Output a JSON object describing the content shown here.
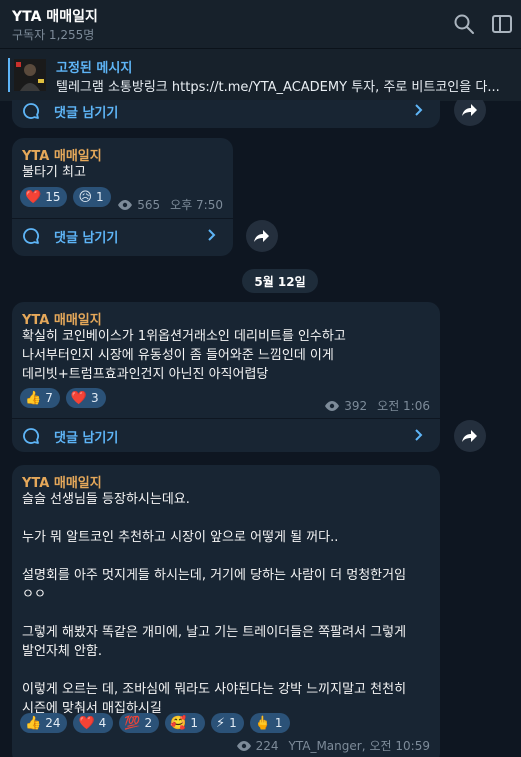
{
  "header": {
    "title": "YTA 매매일지",
    "subscribers": "구독자 1,255명"
  },
  "pinned": {
    "title": "고정된 메시지",
    "text": "텔레그램 소통방링크 https://t.me/YTA_ACADEMY 투자, 주로 비트코인을 다..."
  },
  "comments_label": "댓글 남기기",
  "date_separator": "5월 12일",
  "messages": [
    {
      "sender": "YTA 매매일지",
      "text": "불타기 최고",
      "reactions": [
        {
          "emoji": "❤️",
          "count": "15"
        },
        {
          "emoji": "😥",
          "count": "1"
        }
      ],
      "views": "565",
      "time": "오후 7:50"
    },
    {
      "sender": "YTA 매매일지",
      "text": "확실히 코인베이스가 1위옵션거래소인 데리비트를 인수하고\n나서부터인지 시장에 유동성이 좀 들어와준 느낌인데 이게\n데리빗+트럼프효과인건지 아닌진 아직어렵당",
      "reactions": [
        {
          "emoji": "👍",
          "count": "7"
        },
        {
          "emoji": "❤️",
          "count": "3"
        }
      ],
      "views": "392",
      "time": "오전 1:06"
    },
    {
      "sender": "YTA 매매일지",
      "text": "슬슬 선생님들 등장하시는데요.\n\n누가 뭐 알트코인 추천하고 시장이 앞으로 어떻게 될 꺼다..\n\n설명회를 아주 멋지게들 하시는데, 거기에 당하는 사람이 더 멍청한거임\nㅇㅇ\n\n그렇게 해봤자 똑같은 개미에, 날고 기는 트레이더들은 쪽팔려서 그렇게\n발언자체 안함.\n\n이렇게 오르는 데, 조바심에 뭐라도 사야된다는 강박 느끼지말고 천천히\n시즌에 맞춰서 매집하시길",
      "reactions": [
        {
          "emoji": "👍",
          "count": "24"
        },
        {
          "emoji": "❤️",
          "count": "4"
        },
        {
          "emoji": "💯",
          "count": "2"
        },
        {
          "emoji": "🥰",
          "count": "1"
        },
        {
          "emoji": "⚡",
          "count": "1"
        },
        {
          "emoji": "🖕",
          "count": "1"
        }
      ],
      "views": "224",
      "author": "YTA_Manger,",
      "time": "오전 10:59"
    }
  ],
  "colors": {
    "background": "#0e1621",
    "bubble": "#182533",
    "sender": "#e5a85a",
    "link": "#5eb5f7",
    "reaction": "#2b5278"
  },
  "icons": [
    "search-icon",
    "menu-icon",
    "comment-icon",
    "chevron-right-icon",
    "forward-icon",
    "eye-icon"
  ]
}
